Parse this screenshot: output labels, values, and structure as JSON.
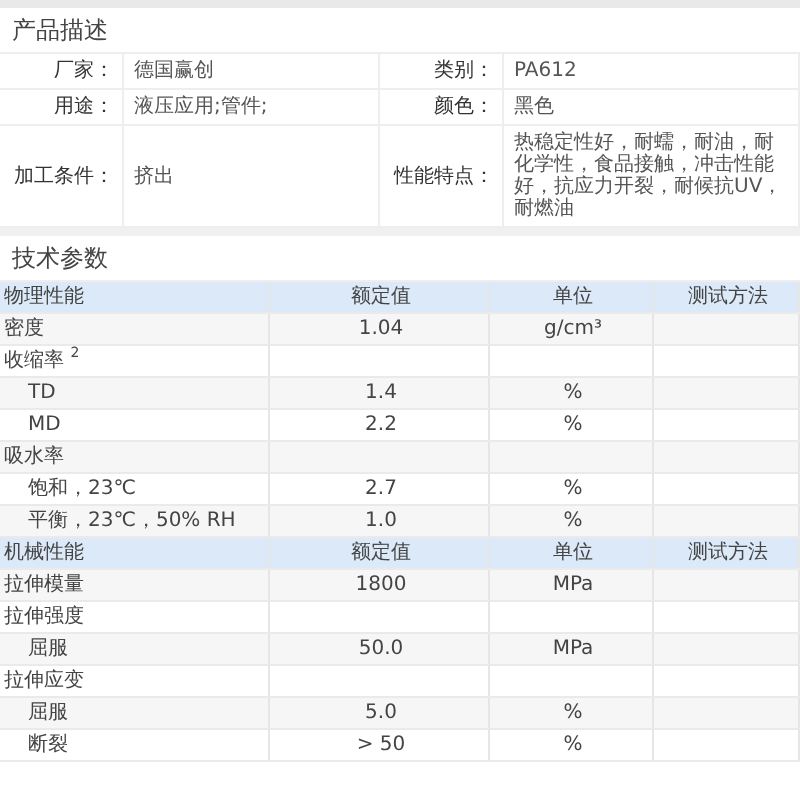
{
  "product": {
    "title": "产品描述",
    "rows": [
      [
        {
          "label": "厂家：",
          "value": "德国赢创"
        },
        {
          "label": "类别：",
          "value": "PA612"
        }
      ],
      [
        {
          "label": "用途：",
          "value": "液压应用;管件;"
        },
        {
          "label": "颜色：",
          "value": "黑色"
        }
      ],
      [
        {
          "label": "加工条件：",
          "value": "挤出"
        },
        {
          "label": "性能特点：",
          "value": "热稳定性好，耐蠕，耐油，耐化学性，食品接触，冲击性能好，抗应力开裂，耐候抗UV，耐燃油"
        }
      ]
    ]
  },
  "tech": {
    "title": "技术参数",
    "groups": [
      {
        "columns": [
          "物理性能",
          "额定值",
          "单位",
          "测试方法"
        ],
        "rows": [
          {
            "kind": "main",
            "name": "密度",
            "value": "1.04",
            "unit": "g/cm³"
          },
          {
            "kind": "main",
            "name": "收缩率 $^{2}$"
          },
          {
            "kind": "sub",
            "name": "TD",
            "value": "1.4",
            "unit": "%"
          },
          {
            "kind": "sub",
            "name": "MD",
            "value": "2.2",
            "unit": "%"
          },
          {
            "kind": "main",
            "name": "吸水率"
          },
          {
            "kind": "sub",
            "name": "饱和，23℃",
            "value": "2.7",
            "unit": "%"
          },
          {
            "kind": "sub",
            "name": "平衡，23℃，50% RH",
            "value": "1.0",
            "unit": "%"
          }
        ]
      },
      {
        "columns": [
          "机械性能",
          "额定值",
          "单位",
          "测试方法"
        ],
        "rows": [
          {
            "kind": "main",
            "name": "拉伸模量",
            "value": "1800",
            "unit": "MPa"
          },
          {
            "kind": "main",
            "name": "拉伸强度"
          },
          {
            "kind": "sub",
            "name": "屈服",
            "value": "50.0",
            "unit": "MPa"
          },
          {
            "kind": "main",
            "name": "拉伸应变"
          },
          {
            "kind": "sub",
            "name": "屈服",
            "value": "5.0",
            "unit": "%"
          },
          {
            "kind": "sub",
            "name": "断裂",
            "value": "> 50",
            "unit": "%"
          }
        ]
      }
    ]
  }
}
